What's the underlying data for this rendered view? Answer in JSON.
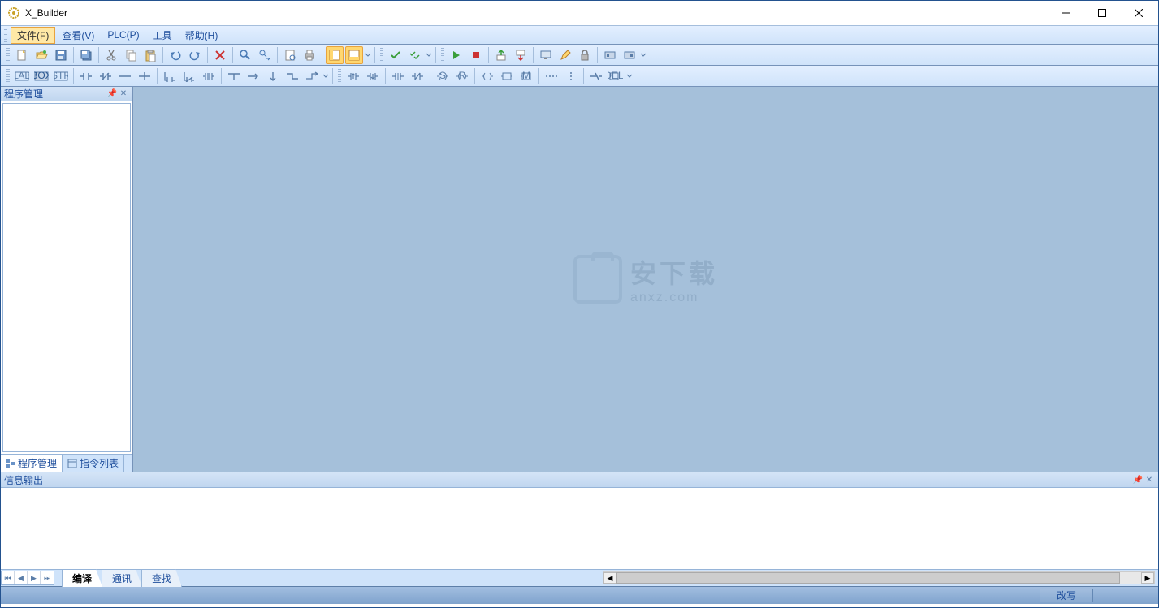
{
  "app": {
    "title": "X_Builder"
  },
  "menu": {
    "file": "文件(F)",
    "view": "查看(V)",
    "plc": "PLC(P)",
    "tools": "工具",
    "help": "帮助(H)"
  },
  "sidebar": {
    "title": "程序管理",
    "tabs": {
      "program_mgmt": "程序管理",
      "instruction_list": "指令列表"
    }
  },
  "output": {
    "title": "信息输出",
    "tabs": {
      "compile": "编译",
      "comm": "通讯",
      "search": "查找"
    }
  },
  "status": {
    "overwrite": "改写"
  },
  "watermark": {
    "cn": "安下载",
    "en": "anxz.com"
  }
}
